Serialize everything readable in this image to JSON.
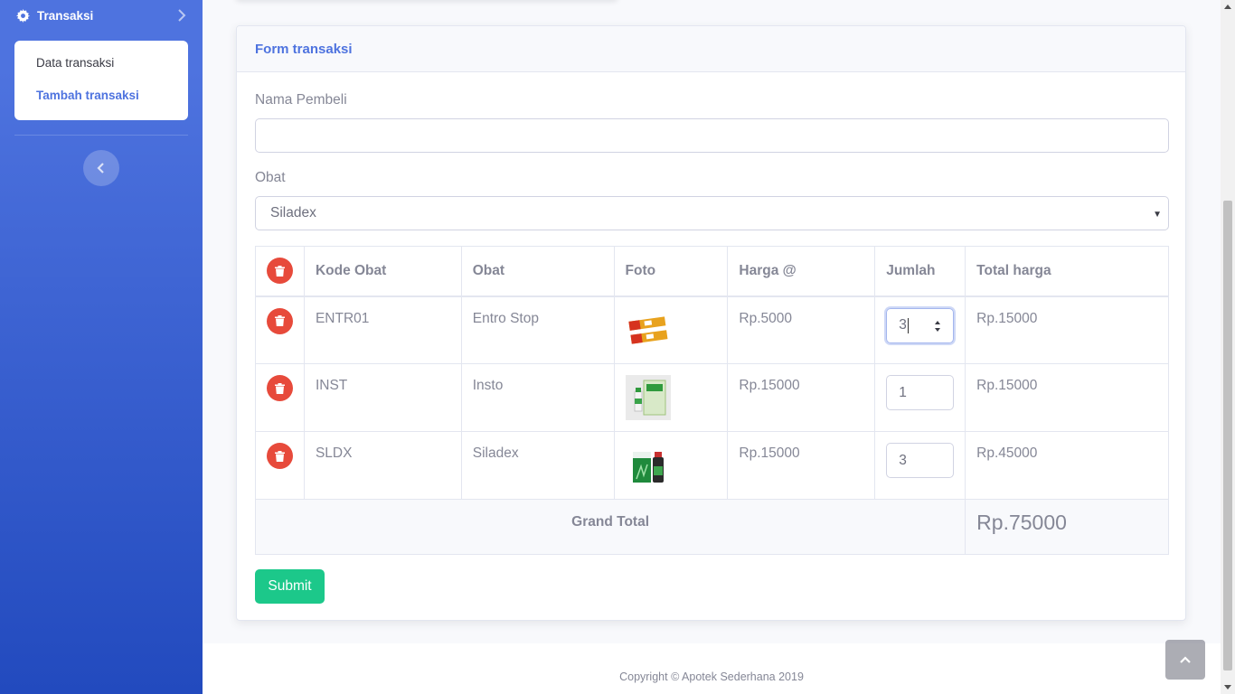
{
  "sidebar": {
    "section_label": "Transaksi",
    "section_icon": "gear-icon",
    "items": [
      {
        "label": "Data transaksi",
        "active": false
      },
      {
        "label": "Tambah transaksi",
        "active": true
      }
    ],
    "toggle_icon": "chevron-left-icon"
  },
  "form": {
    "title": "Form transaksi",
    "buyer_label": "Nama Pembeli",
    "buyer_value": "",
    "medicine_label": "Obat",
    "medicine_selected": "Siladex"
  },
  "table": {
    "headers": [
      "Kode Obat",
      "Obat",
      "Foto",
      "Harga @",
      "Jumlah",
      "Total harga"
    ],
    "rows": [
      {
        "code": "ENTR01",
        "name": "Entro Stop",
        "price": "Rp.5000",
        "qty": "3",
        "total": "Rp.15000"
      },
      {
        "code": "INST",
        "name": "Insto",
        "price": "Rp.15000",
        "qty": "1",
        "total": "Rp.15000"
      },
      {
        "code": "SLDX",
        "name": "Siladex",
        "price": "Rp.15000",
        "qty": "3",
        "total": "Rp.45000"
      }
    ],
    "grand_total_label": "Grand Total",
    "grand_total_value": "Rp.75000"
  },
  "submit_label": "Submit",
  "footer_text": "Copyright © Apotek Sederhana 2019",
  "colors": {
    "primary": "#4e73df",
    "danger": "#e74a3b",
    "success": "#1cc88a"
  }
}
